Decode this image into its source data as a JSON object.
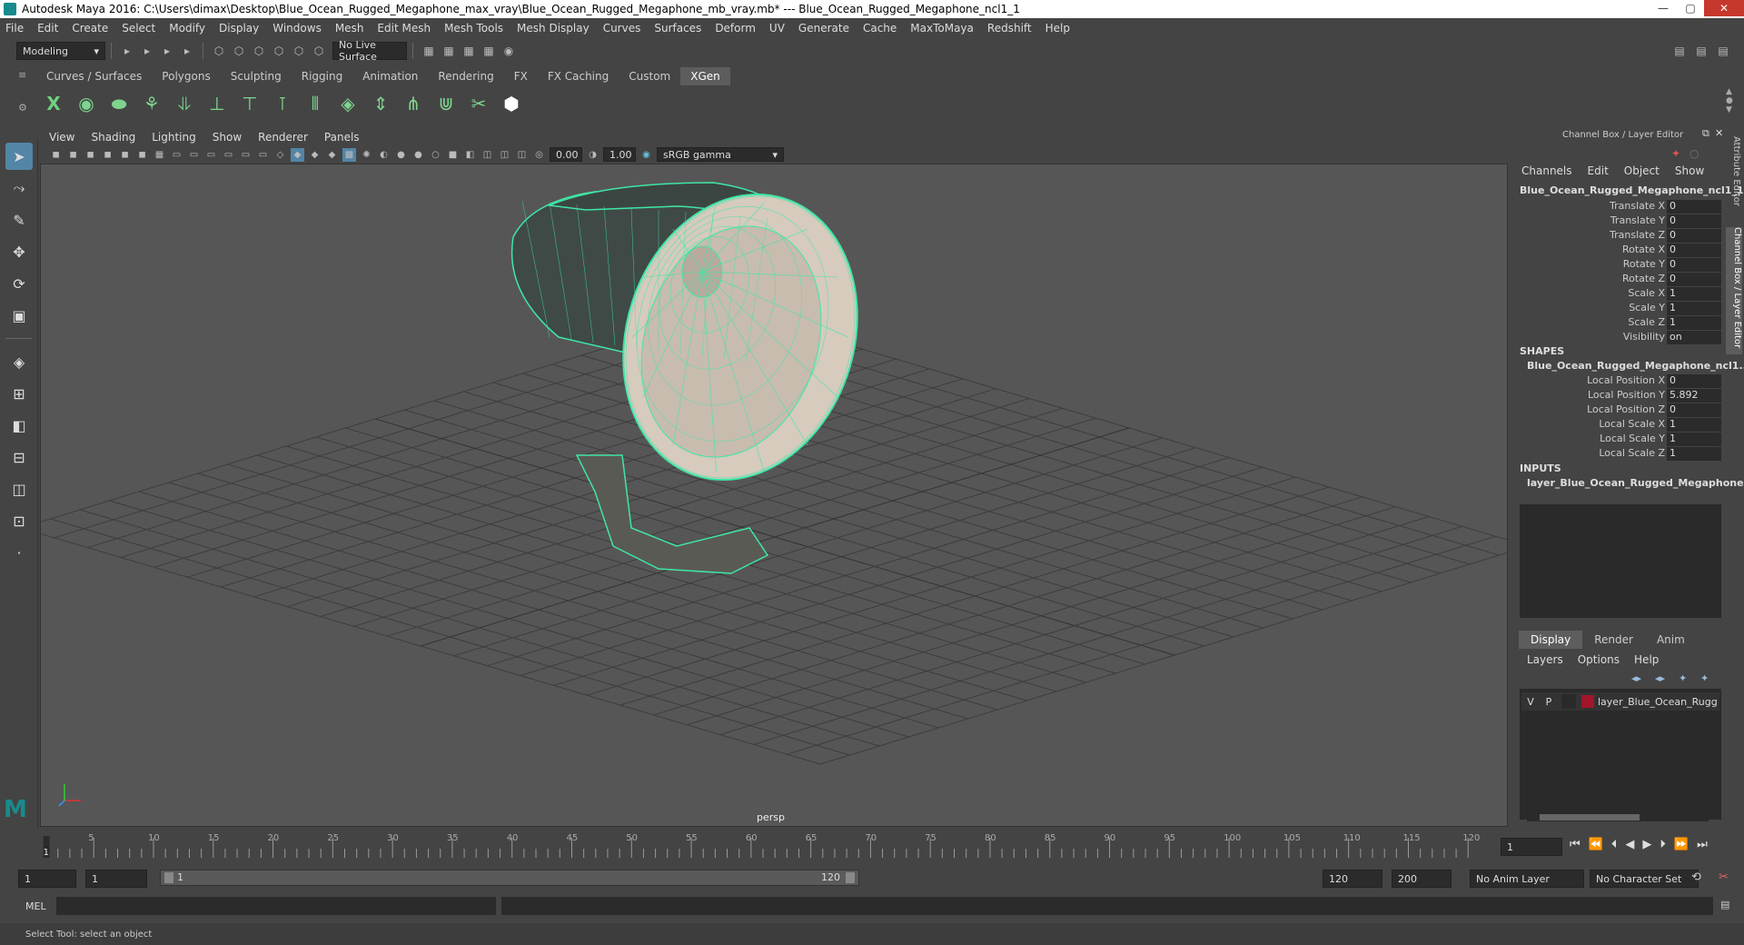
{
  "window": {
    "title": "Autodesk Maya 2016: C:\\Users\\dimax\\Desktop\\Blue_Ocean_Rugged_Megaphone_max_vray\\Blue_Ocean_Rugged_Megaphone_mb_vray.mb*   ---   Blue_Ocean_Rugged_Megaphone_ncl1_1",
    "controls": {
      "minimize": "—",
      "maximize": "▢",
      "close": "✕"
    }
  },
  "menubar": [
    "File",
    "Edit",
    "Create",
    "Select",
    "Modify",
    "Display",
    "Windows",
    "Mesh",
    "Edit Mesh",
    "Mesh Tools",
    "Mesh Display",
    "Curves",
    "Surfaces",
    "Deform",
    "UV",
    "Generate",
    "Cache",
    "MaxToMaya",
    "Redshift",
    "Help"
  ],
  "statusline": {
    "mode": "Modeling",
    "live_surface": "No Live Surface"
  },
  "shelf": {
    "tabs": [
      "Curves / Surfaces",
      "Polygons",
      "Sculpting",
      "Rigging",
      "Animation",
      "Rendering",
      "FX",
      "FX Caching",
      "Custom",
      "XGen"
    ],
    "active_tab": "XGen"
  },
  "viewport": {
    "menu": [
      "View",
      "Shading",
      "Lighting",
      "Show",
      "Renderer",
      "Panels"
    ],
    "exposure": "0.00",
    "gamma": "1.00",
    "color_space": "sRGB gamma",
    "camera_label": "persp"
  },
  "channelbox": {
    "title": "Channel Box / Layer Editor",
    "menu": [
      "Channels",
      "Edit",
      "Object",
      "Show"
    ],
    "object_name": "Blue_Ocean_Rugged_Megaphone_ncl1_1",
    "channels": [
      {
        "label": "Translate X",
        "value": "0"
      },
      {
        "label": "Translate Y",
        "value": "0"
      },
      {
        "label": "Translate Z",
        "value": "0"
      },
      {
        "label": "Rotate X",
        "value": "0"
      },
      {
        "label": "Rotate Y",
        "value": "0"
      },
      {
        "label": "Rotate Z",
        "value": "0"
      },
      {
        "label": "Scale X",
        "value": "1"
      },
      {
        "label": "Scale Y",
        "value": "1"
      },
      {
        "label": "Scale Z",
        "value": "1"
      },
      {
        "label": "Visibility",
        "value": "on"
      }
    ],
    "shapes_header": "SHAPES",
    "shape_name": "Blue_Ocean_Rugged_Megaphone_ncl1...",
    "shape_channels": [
      {
        "label": "Local Position X",
        "value": "0"
      },
      {
        "label": "Local Position Y",
        "value": "5.892"
      },
      {
        "label": "Local Position Z",
        "value": "0"
      },
      {
        "label": "Local Scale X",
        "value": "1"
      },
      {
        "label": "Local Scale Y",
        "value": "1"
      },
      {
        "label": "Local Scale Z",
        "value": "1"
      }
    ],
    "inputs_header": "INPUTS",
    "input_name": "layer_Blue_Ocean_Rugged_Megaphone"
  },
  "layers": {
    "tabs": [
      "Display",
      "Render",
      "Anim"
    ],
    "active_tab": "Display",
    "menu": [
      "Layers",
      "Options",
      "Help"
    ],
    "rows": [
      {
        "v": "V",
        "p": "P",
        "name": "layer_Blue_Ocean_Rugg",
        "color": "#a3142a"
      }
    ]
  },
  "side_tabs": [
    "Attribute Editor",
    "Channel Box / Layer Editor"
  ],
  "timeline": {
    "ticks": [
      "5",
      "10",
      "15",
      "20",
      "25",
      "30",
      "35",
      "40",
      "45",
      "50",
      "55",
      "60",
      "65",
      "70",
      "75",
      "80",
      "85",
      "90",
      "95",
      "100",
      "105",
      "110",
      "115",
      "120"
    ],
    "current_frame_marker": "1",
    "current_frame": "1"
  },
  "range": {
    "start": "1",
    "anim_start": "1",
    "slider_start": "1",
    "slider_end": "120",
    "anim_end": "120",
    "end": "200",
    "anim_layer": "No Anim Layer",
    "character_set": "No Character Set"
  },
  "cmdline": {
    "label": "MEL"
  },
  "status": {
    "help_text": "Select Tool: select an object"
  },
  "colors": {
    "mesh_wire": "#3fe6a6",
    "accent": "#5285a6",
    "layer_color": "#a3142a"
  }
}
